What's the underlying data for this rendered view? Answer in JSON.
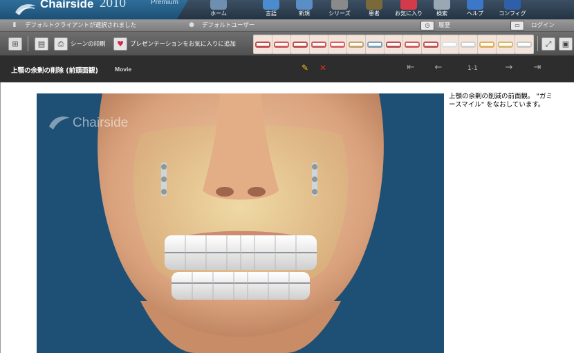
{
  "app": {
    "brand": "Chairside",
    "trademark": "®",
    "year": "2010",
    "edition": "Premium"
  },
  "nav": [
    {
      "id": "home",
      "label": "ホーム",
      "icon": "home-icon"
    },
    {
      "id": "glossary",
      "label": "言語",
      "icon": "book-icon"
    },
    {
      "id": "new",
      "label": "新規",
      "icon": "new-icon"
    },
    {
      "id": "series",
      "label": "シリーズ",
      "icon": "film-icon"
    },
    {
      "id": "patient",
      "label": "患者",
      "icon": "patient-icon"
    },
    {
      "id": "favorites",
      "label": "お気に入り",
      "icon": "heart-icon"
    },
    {
      "id": "search",
      "label": "検索",
      "icon": "search-icon"
    },
    {
      "id": "help",
      "label": "ヘルプ",
      "icon": "help-icon"
    },
    {
      "id": "config",
      "label": "コンフィグ",
      "icon": "gear-icon"
    }
  ],
  "status": {
    "client": "デフォルトクライアントが選択されました",
    "user": "デフォルトユーザー",
    "history": "履歴",
    "login": "ログイン"
  },
  "toolbar": {
    "print_scene": "シーンの印刷",
    "add_favorite": "プレゼンテーションをお気に入りに追加"
  },
  "thumbs": [
    {
      "name": "thumb-1",
      "color": "#c44b4b"
    },
    {
      "name": "thumb-2",
      "color": "#d45a5a"
    },
    {
      "name": "thumb-3",
      "color": "#c0504f"
    },
    {
      "name": "thumb-4",
      "color": "#cb5a60"
    },
    {
      "name": "thumb-5",
      "color": "#d96464"
    },
    {
      "name": "thumb-6",
      "color": "#c9a070"
    },
    {
      "name": "thumb-7",
      "color": "#7fa0b8"
    },
    {
      "name": "thumb-8",
      "color": "#bd5050"
    },
    {
      "name": "thumb-9",
      "color": "#d06060"
    },
    {
      "name": "thumb-10",
      "color": "#c25656"
    },
    {
      "name": "thumb-11",
      "color": "#e0e0e0"
    },
    {
      "name": "thumb-12",
      "color": "#cfcfcf"
    },
    {
      "name": "thumb-13",
      "color": "#e0b060"
    },
    {
      "name": "thumb-14",
      "color": "#d8b870"
    },
    {
      "name": "thumb-15",
      "color": "#c8c8c8"
    }
  ],
  "movie": {
    "title": "上顎の余剰の削除 (前頭面観)",
    "type": "Movie",
    "page": "1-1"
  },
  "watermark": "Chairside",
  "description": "上顎の余剰の削減の前面観。 \"ガミースマイル\" をなおしています。"
}
